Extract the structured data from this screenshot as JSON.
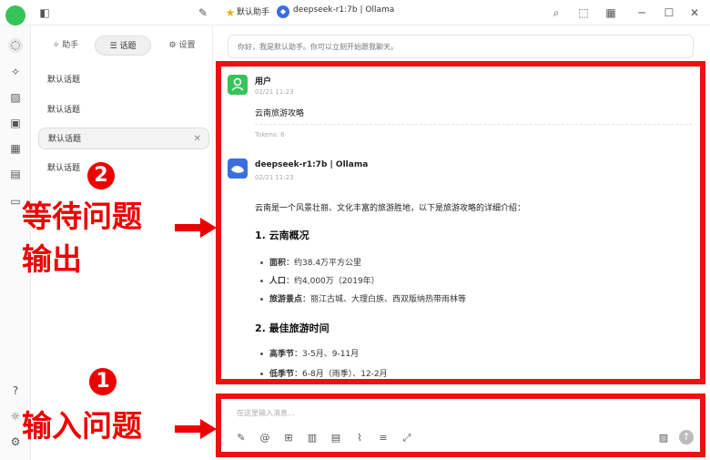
{
  "topbar": {
    "assistant_label": "默认助手",
    "model_label": "deepseek-r1:7b | Ollama"
  },
  "sidebar": {
    "tabs": [
      {
        "label": "助手"
      },
      {
        "label": "话题"
      },
      {
        "label": "设置"
      }
    ],
    "topics": [
      "默认话题",
      "默认话题",
      "默认话题",
      "默认话题"
    ]
  },
  "welcome_text": "你好，我是默认助手。你可以立刻开始跟我聊天。",
  "messages": {
    "user": {
      "name": "用户",
      "time": "02/21 11:23",
      "content": "云南旅游攻略",
      "tokens": "Tokens: 6"
    },
    "assistant": {
      "name": "deepseek-r1:7b | Ollama",
      "time": "02/21 11:23",
      "intro": "云南是一个风景壮丽、文化丰富的旅游胜地，以下是旅游攻略的详细介绍：",
      "section1_title": "1. 云南概况",
      "section1_items": [
        {
          "label": "面积",
          "value": "：约38.4万平方公里"
        },
        {
          "label": "人口",
          "value": "：约4,000万（2019年）"
        },
        {
          "label": "旅游景点",
          "value": "：丽江古城、大理白族、西双版纳热带雨林等"
        }
      ],
      "section2_title": "2. 最佳旅游时间",
      "section2_items": [
        {
          "label": "高季节",
          "value": "：3-5月、9-11月"
        },
        {
          "label": "低季节",
          "value": "：6-8月（雨季）、12-2月"
        }
      ]
    }
  },
  "input": {
    "placeholder": "在这里输入消息..."
  },
  "annotations": {
    "step2_number": "2",
    "step2_text_line1": "等待问题",
    "step2_text_line2": "输出",
    "step1_number": "1",
    "step1_text": "输入问题"
  },
  "colors": {
    "highlight": "#ee1111",
    "user_avatar": "#36c45a",
    "assistant_avatar": "#3b6fe0"
  }
}
